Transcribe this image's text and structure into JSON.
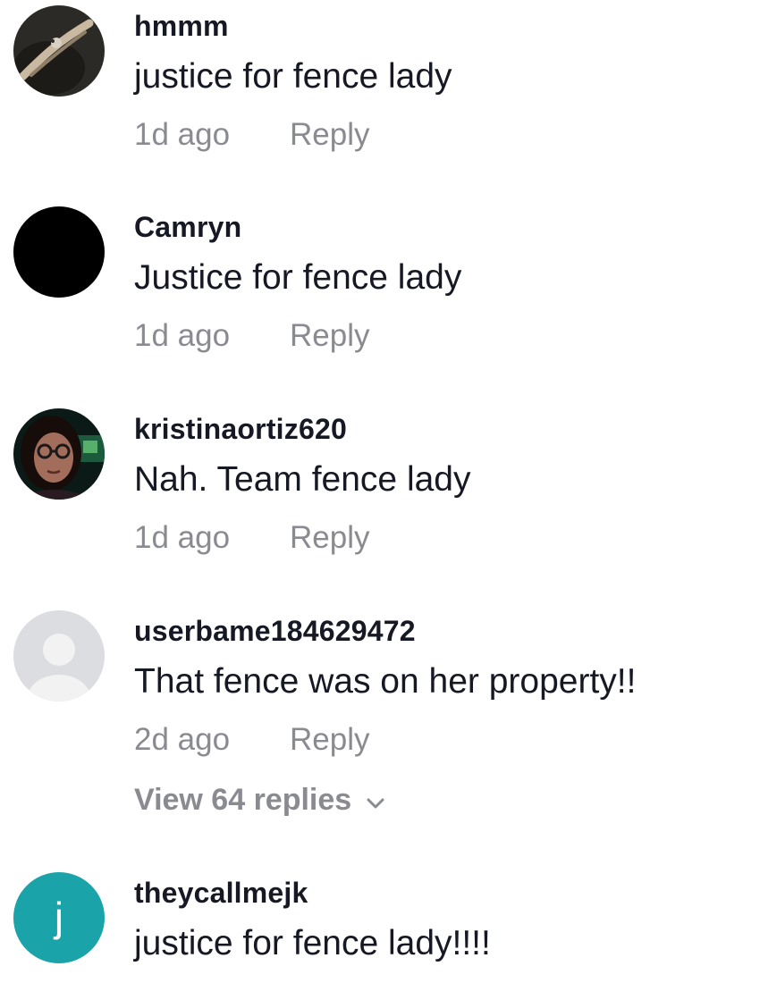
{
  "comments": [
    {
      "username": "hmmm",
      "text": "justice for fence lady",
      "time": "1d ago",
      "reply": "Reply",
      "avatar_icon": "photo-avatar-hand"
    },
    {
      "username": "Camryn",
      "text": "Justice for fence lady",
      "time": "1d ago",
      "reply": "Reply",
      "avatar_icon": "black-avatar"
    },
    {
      "username": "kristinaortiz620",
      "text": "Nah. Team fence lady",
      "time": "1d ago",
      "reply": "Reply",
      "avatar_icon": "photo-avatar-person"
    },
    {
      "username": "userbame184629472",
      "text": "That fence was on her property!!",
      "time": "2d ago",
      "reply": "Reply",
      "view_replies": "View 64 replies",
      "avatar_icon": "default-user-avatar"
    },
    {
      "username": "theycallmejk",
      "text": "justice for fence lady!!!!",
      "avatar_letter": "j",
      "avatar_color": "#1aa3a8",
      "avatar_icon": "letter-avatar"
    }
  ],
  "colors": {
    "primary_text": "#161823",
    "secondary_text": "#8a8b91"
  }
}
